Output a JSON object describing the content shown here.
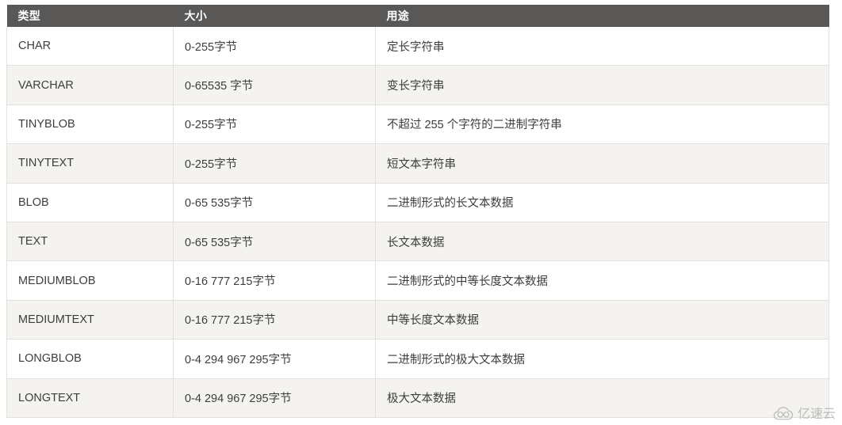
{
  "table": {
    "columns": [
      {
        "key": "type",
        "label": "类型"
      },
      {
        "key": "size",
        "label": "大小"
      },
      {
        "key": "usage",
        "label": "用途"
      }
    ],
    "rows": [
      {
        "type": "CHAR",
        "size": "0-255字节",
        "usage": "定长字符串"
      },
      {
        "type": "VARCHAR",
        "size": "0-65535 字节",
        "usage": "变长字符串"
      },
      {
        "type": "TINYBLOB",
        "size": "0-255字节",
        "usage": "不超过 255 个字符的二进制字符串"
      },
      {
        "type": "TINYTEXT",
        "size": "0-255字节",
        "usage": "短文本字符串"
      },
      {
        "type": "BLOB",
        "size": "0-65 535字节",
        "usage": "二进制形式的长文本数据"
      },
      {
        "type": "TEXT",
        "size": "0-65 535字节",
        "usage": "长文本数据"
      },
      {
        "type": "MEDIUMBLOB",
        "size": "0-16 777 215字节",
        "usage": "二进制形式的中等长度文本数据"
      },
      {
        "type": "MEDIUMTEXT",
        "size": "0-16 777 215字节",
        "usage": "中等长度文本数据"
      },
      {
        "type": "LONGBLOB",
        "size": "0-4 294 967 295字节",
        "usage": "二进制形式的极大文本数据"
      },
      {
        "type": "LONGTEXT",
        "size": "0-4 294 967 295字节",
        "usage": "极大文本数据"
      }
    ]
  },
  "watermark": {
    "text": "亿速云",
    "icon": "cloud-logo-icon"
  },
  "colors": {
    "header_bg": "#595857",
    "header_text": "#ffffff",
    "row_odd_bg": "#ffffff",
    "row_even_bg": "#f4f3ef",
    "border": "#e3e1dd",
    "body_text": "#3d3d3d",
    "watermark_text": "#8f8f8f"
  }
}
